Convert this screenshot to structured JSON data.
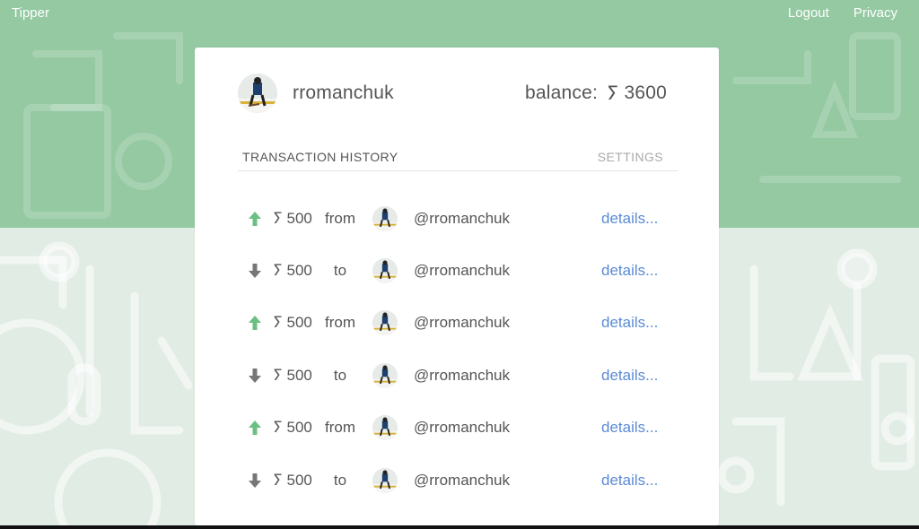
{
  "nav": {
    "brand": "Tipper",
    "logout": "Logout",
    "privacy": "Privacy"
  },
  "profile": {
    "username": "rromanchuk",
    "balance_label": "balance:",
    "currency_symbol": "ⵢ",
    "balance_amount": "3600"
  },
  "tabs": {
    "history": "TRANSACTION HISTORY",
    "settings": "SETTINGS"
  },
  "colors": {
    "header_green": "#94c9a2",
    "incoming_arrow": "#6cbf84",
    "outgoing_arrow": "#777777",
    "link_blue": "#5b8bd6"
  },
  "transactions": [
    {
      "direction": "in",
      "arrow_icon": "arrow-up-icon",
      "currency": "ⵢ",
      "amount": "500",
      "preposition": "from",
      "user": "@rromanchuk",
      "details": "details..."
    },
    {
      "direction": "out",
      "arrow_icon": "arrow-down-icon",
      "currency": "ⵢ",
      "amount": "500",
      "preposition": "to",
      "user": "@rromanchuk",
      "details": "details..."
    },
    {
      "direction": "in",
      "arrow_icon": "arrow-up-icon",
      "currency": "ⵢ",
      "amount": "500",
      "preposition": "from",
      "user": "@rromanchuk",
      "details": "details..."
    },
    {
      "direction": "out",
      "arrow_icon": "arrow-down-icon",
      "currency": "ⵢ",
      "amount": "500",
      "preposition": "to",
      "user": "@rromanchuk",
      "details": "details..."
    },
    {
      "direction": "in",
      "arrow_icon": "arrow-up-icon",
      "currency": "ⵢ",
      "amount": "500",
      "preposition": "from",
      "user": "@rromanchuk",
      "details": "details..."
    },
    {
      "direction": "out",
      "arrow_icon": "arrow-down-icon",
      "currency": "ⵢ",
      "amount": "500",
      "preposition": "to",
      "user": "@rromanchuk",
      "details": "details..."
    }
  ]
}
